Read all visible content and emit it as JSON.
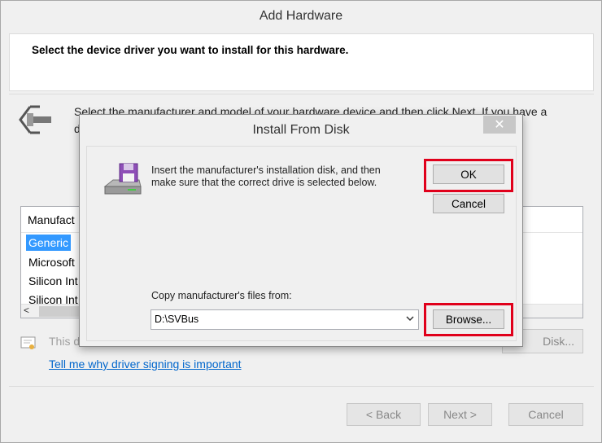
{
  "outer": {
    "title": "Add Hardware",
    "header": "Select the device driver you want to install for this hardware.",
    "instruction_line1": "Select the manufacturer and model of your hardware device and then click Next. If you have a",
    "instruction_line2_visible": "d",
    "list": {
      "header": "Manufact",
      "items": [
        "Generic",
        "Microsoft",
        "Silicon Int",
        "Silicon Int"
      ],
      "selected_index": 0
    },
    "signed_text": "This d",
    "have_disk_label": "Disk...",
    "signing_link": "Tell me why driver signing is important",
    "back_label": "< Back",
    "next_label": "Next >",
    "cancel_label": "Cancel"
  },
  "dialog": {
    "title": "Install From Disk",
    "close_glyph": "✕",
    "message_line1": "Insert the manufacturer's installation disk, and then",
    "message_line2": "make sure that the correct drive is selected below.",
    "ok_label": "OK",
    "cancel_label": "Cancel",
    "copy_label": "Copy manufacturer's files from:",
    "path_value": "D:\\SVBus",
    "browse_label": "Browse..."
  },
  "colors": {
    "highlight_frame": "#e0001b",
    "selection": "#3399ff",
    "link": "#0066cc"
  },
  "icons": [
    "device-wizard-icon",
    "floppy-disk-drive-icon",
    "certificate-icon",
    "close-icon",
    "chevron-down-icon",
    "scroll-left-icon"
  ]
}
